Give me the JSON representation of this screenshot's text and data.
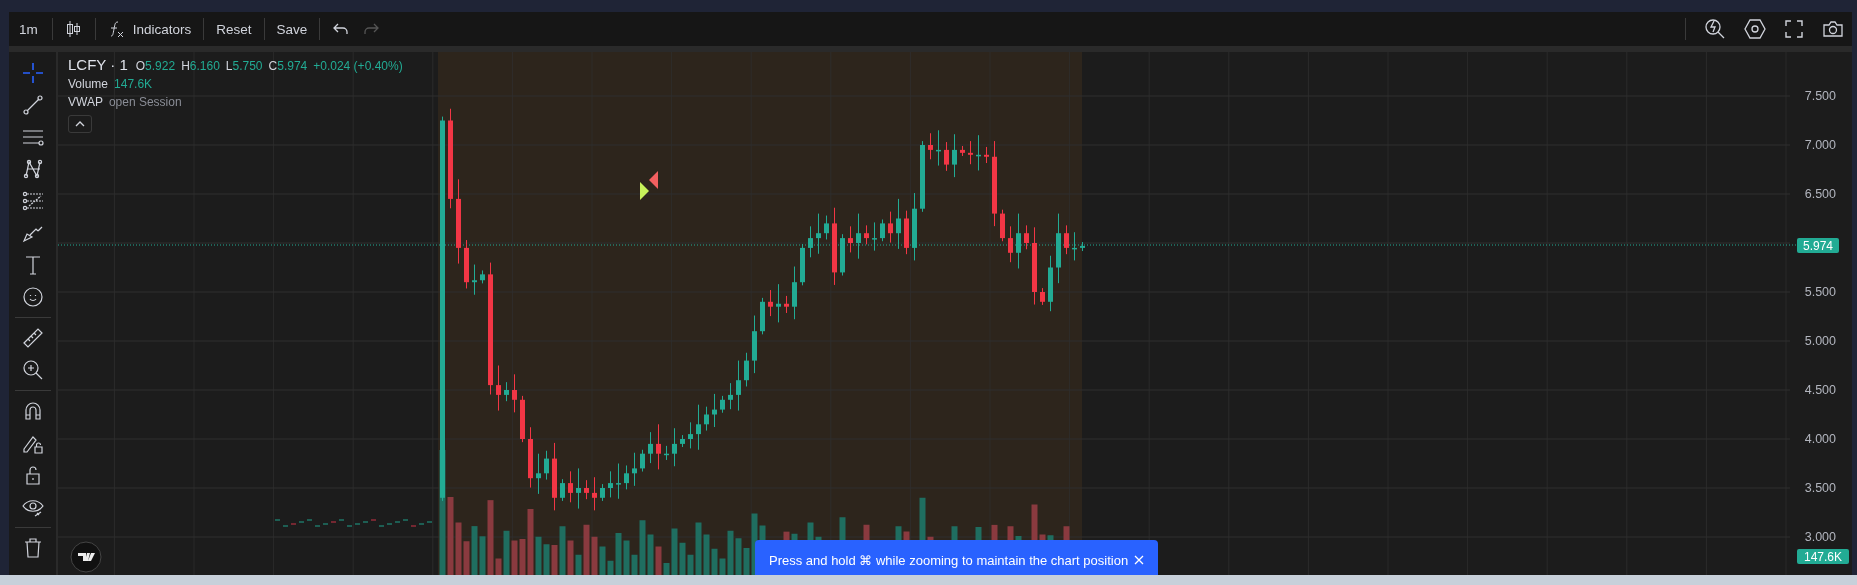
{
  "toolbar": {
    "interval": "1m",
    "indicators": "Indicators",
    "reset": "Reset",
    "save": "Save",
    "undo": {
      "disabled": false
    },
    "redo": {
      "disabled": true
    }
  },
  "drawing_tools": [
    {
      "kind": "crosshair",
      "selected": true
    },
    {
      "kind": "trend-line",
      "selected": false
    },
    {
      "kind": "lines",
      "selected": false
    },
    {
      "kind": "pattern",
      "selected": false
    },
    {
      "kind": "fib",
      "selected": false
    },
    {
      "kind": "brush",
      "selected": false
    },
    {
      "kind": "text",
      "selected": false
    },
    {
      "kind": "emoji",
      "selected": false
    },
    {
      "kind": "divider"
    },
    {
      "kind": "ruler",
      "selected": false
    },
    {
      "kind": "zoom",
      "selected": false
    },
    {
      "kind": "divider"
    },
    {
      "kind": "magnet",
      "selected": false
    },
    {
      "kind": "lock-drawing",
      "selected": false
    },
    {
      "kind": "lock",
      "selected": false
    },
    {
      "kind": "eye",
      "selected": false
    },
    {
      "kind": "divider"
    },
    {
      "kind": "trash",
      "selected": false
    }
  ],
  "legend": {
    "symbol": "LCFY · 1",
    "ohlc": [
      {
        "label": "O",
        "value": "5.922"
      },
      {
        "label": "H",
        "value": "6.160"
      },
      {
        "label": "L",
        "value": "5.750"
      },
      {
        "label": "C",
        "value": "5.974"
      }
    ],
    "change": "+0.024 (+0.40%)",
    "volume_label": "Volume",
    "volume": "147.6K",
    "vwap": "VWAP",
    "vwap_setting": "open Session"
  },
  "price_axis": [
    "7.500",
    "7.000",
    "6.500",
    "5.500",
    "5.000",
    "4.500",
    "4.000",
    "3.500",
    "3.000"
  ],
  "last_price": "5.974",
  "last_volume": "147.6K",
  "toast": {
    "text": "Press and hold ⌘ while zooming to maintain the chart position"
  }
}
